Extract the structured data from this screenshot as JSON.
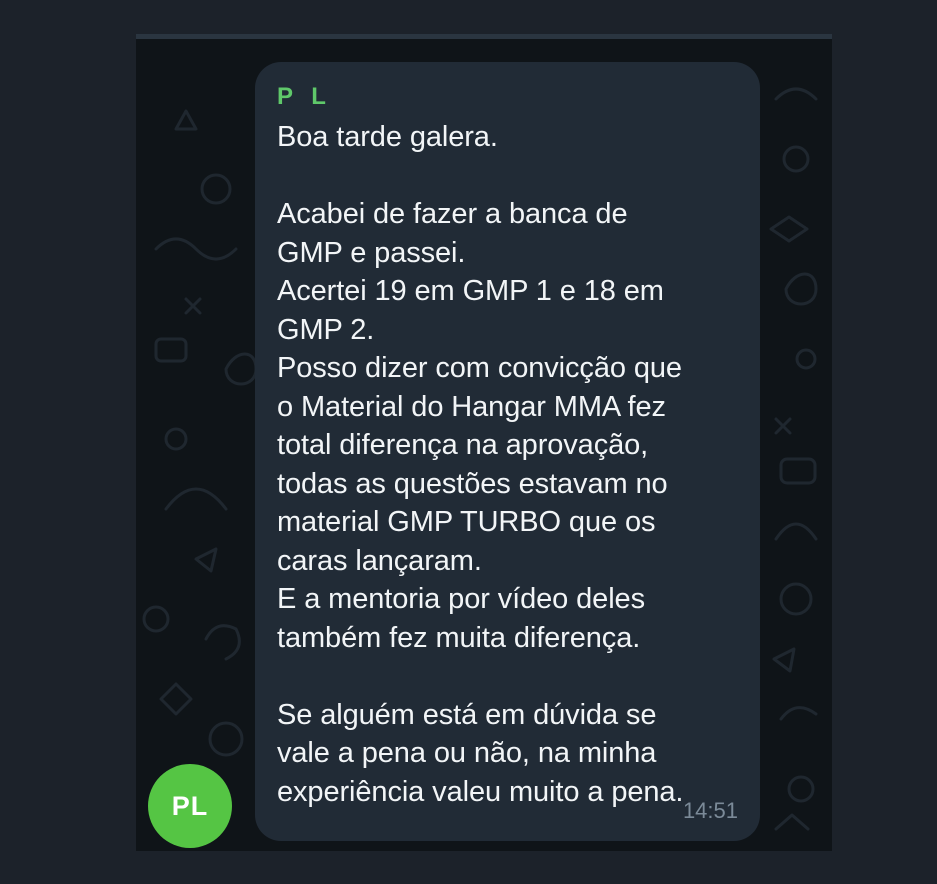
{
  "message": {
    "sender": "P L",
    "text": "Boa tarde galera.\n\nAcabei de fazer a banca de\nGMP e passei.\nAcertei 19 em GMP 1 e 18 em\nGMP 2.\nPosso dizer com convicção que\no Material do Hangar MMA fez\ntotal diferença na aprovação,\ntodas as questões estavam no\nmaterial GMP TURBO que os\ncaras lançaram.\nE a mentoria por vídeo deles\ntambém fez muita diferença.\n\nSe alguém está em dúvida se\nvale a pena ou não, na minha\nexperiência valeu muito a pena.",
    "time": "14:51"
  },
  "avatar": {
    "initials": "PL"
  },
  "colors": {
    "chat_background": "#0f1418",
    "bubble": "#212b36",
    "sender_name": "#5fc86a",
    "avatar": "#55c544",
    "message_text": "#f2f5f7",
    "timestamp": "#7b8a98"
  }
}
